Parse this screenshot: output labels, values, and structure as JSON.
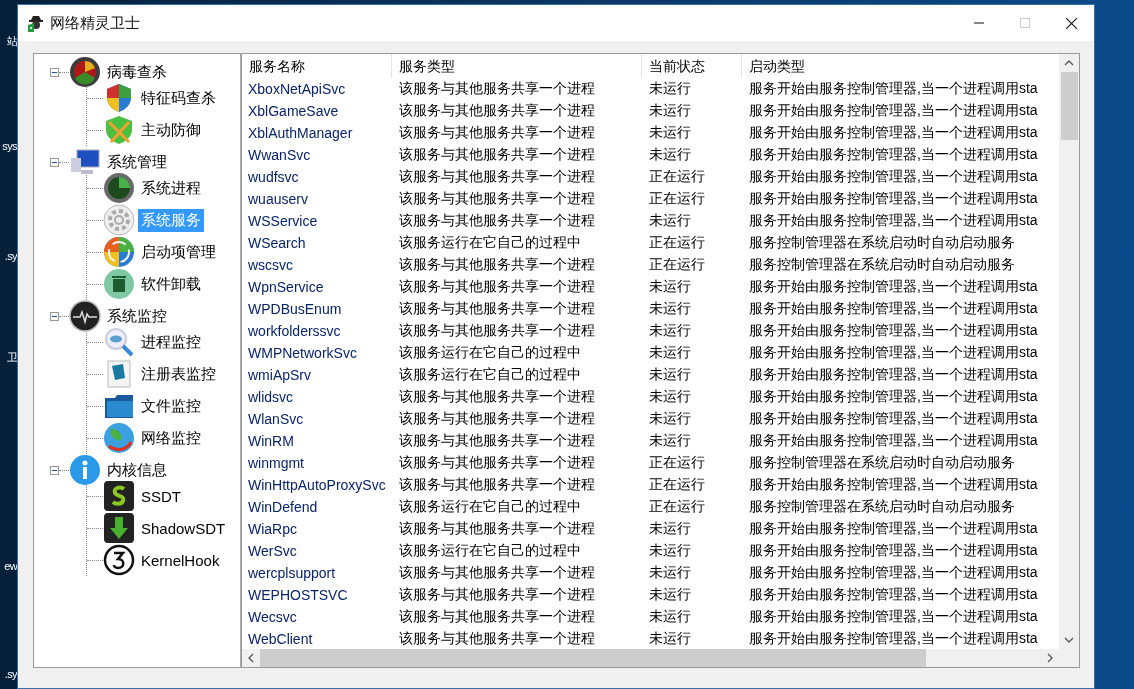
{
  "desktop": {
    "labels": [
      "站",
      "sys",
      ".sy",
      "卫",
      "ew",
      ".sy"
    ]
  },
  "window": {
    "title": "网络精灵卫士",
    "maximize_disabled": true
  },
  "tree": [
    {
      "label": "病毒查杀",
      "expanded": true,
      "selected": false,
      "children": [
        {
          "label": "特征码查杀",
          "selected": false
        },
        {
          "label": "主动防御",
          "selected": false
        }
      ]
    },
    {
      "label": "系统管理",
      "expanded": true,
      "selected": false,
      "children": [
        {
          "label": "系统进程",
          "selected": false
        },
        {
          "label": "系统服务",
          "selected": true
        },
        {
          "label": "启动项管理",
          "selected": false
        },
        {
          "label": "软件卸载",
          "selected": false
        }
      ]
    },
    {
      "label": "系统监控",
      "expanded": true,
      "selected": false,
      "children": [
        {
          "label": "进程监控",
          "selected": false
        },
        {
          "label": "注册表监控",
          "selected": false
        },
        {
          "label": "文件监控",
          "selected": false
        },
        {
          "label": "网络监控",
          "selected": false
        }
      ]
    },
    {
      "label": "内核信息",
      "expanded": true,
      "selected": false,
      "children": [
        {
          "label": "SSDT",
          "selected": false
        },
        {
          "label": "ShadowSDT",
          "selected": false
        },
        {
          "label": "KernelHook",
          "selected": false
        }
      ]
    }
  ],
  "table": {
    "columns": [
      "服务名称",
      "服务类型",
      "当前状态",
      "启动类型"
    ],
    "rows": [
      [
        "XboxNetApiSvc",
        "该服务与其他服务共享一个进程",
        "未运行",
        "服务开始由服务控制管理器,当一个进程调用sta"
      ],
      [
        "XblGameSave",
        "该服务与其他服务共享一个进程",
        "未运行",
        "服务开始由服务控制管理器,当一个进程调用sta"
      ],
      [
        "XblAuthManager",
        "该服务与其他服务共享一个进程",
        "未运行",
        "服务开始由服务控制管理器,当一个进程调用sta"
      ],
      [
        "WwanSvc",
        "该服务与其他服务共享一个进程",
        "未运行",
        "服务开始由服务控制管理器,当一个进程调用sta"
      ],
      [
        "wudfsvc",
        "该服务与其他服务共享一个进程",
        "正在运行",
        "服务开始由服务控制管理器,当一个进程调用sta"
      ],
      [
        "wuauserv",
        "该服务与其他服务共享一个进程",
        "正在运行",
        "服务开始由服务控制管理器,当一个进程调用sta"
      ],
      [
        "WSService",
        "该服务与其他服务共享一个进程",
        "未运行",
        "服务开始由服务控制管理器,当一个进程调用sta"
      ],
      [
        "WSearch",
        "该服务运行在它自己的过程中",
        "正在运行",
        "服务控制管理器在系统启动时自动启动服务"
      ],
      [
        "wscsvc",
        "该服务与其他服务共享一个进程",
        "正在运行",
        "服务控制管理器在系统启动时自动启动服务"
      ],
      [
        "WpnService",
        "该服务与其他服务共享一个进程",
        "未运行",
        "服务开始由服务控制管理器,当一个进程调用sta"
      ],
      [
        "WPDBusEnum",
        "该服务与其他服务共享一个进程",
        "未运行",
        "服务开始由服务控制管理器,当一个进程调用sta"
      ],
      [
        "workfolderssvc",
        "该服务与其他服务共享一个进程",
        "未运行",
        "服务开始由服务控制管理器,当一个进程调用sta"
      ],
      [
        "WMPNetworkSvc",
        "该服务运行在它自己的过程中",
        "未运行",
        "服务开始由服务控制管理器,当一个进程调用sta"
      ],
      [
        "wmiApSrv",
        "该服务运行在它自己的过程中",
        "未运行",
        "服务开始由服务控制管理器,当一个进程调用sta"
      ],
      [
        "wlidsvc",
        "该服务与其他服务共享一个进程",
        "未运行",
        "服务开始由服务控制管理器,当一个进程调用sta"
      ],
      [
        "WlanSvc",
        "该服务与其他服务共享一个进程",
        "未运行",
        "服务开始由服务控制管理器,当一个进程调用sta"
      ],
      [
        "WinRM",
        "该服务与其他服务共享一个进程",
        "未运行",
        "服务开始由服务控制管理器,当一个进程调用sta"
      ],
      [
        "winmgmt",
        "该服务与其他服务共享一个进程",
        "正在运行",
        "服务控制管理器在系统启动时自动启动服务"
      ],
      [
        "WinHttpAutoProxySvc",
        "该服务与其他服务共享一个进程",
        "正在运行",
        "服务开始由服务控制管理器,当一个进程调用sta"
      ],
      [
        "WinDefend",
        "该服务运行在它自己的过程中",
        "正在运行",
        "服务控制管理器在系统启动时自动启动服务"
      ],
      [
        "WiaRpc",
        "该服务与其他服务共享一个进程",
        "未运行",
        "服务开始由服务控制管理器,当一个进程调用sta"
      ],
      [
        "WerSvc",
        "该服务运行在它自己的过程中",
        "未运行",
        "服务开始由服务控制管理器,当一个进程调用sta"
      ],
      [
        "wercplsupport",
        "该服务与其他服务共享一个进程",
        "未运行",
        "服务开始由服务控制管理器,当一个进程调用sta"
      ],
      [
        "WEPHOSTSVC",
        "该服务与其他服务共享一个进程",
        "未运行",
        "服务开始由服务控制管理器,当一个进程调用sta"
      ],
      [
        "Wecsvc",
        "该服务与其他服务共享一个进程",
        "未运行",
        "服务开始由服务控制管理器,当一个进程调用sta"
      ],
      [
        "WebClient",
        "该服务与其他服务共享一个进程",
        "未运行",
        "服务开始由服务控制管理器,当一个进程调用sta"
      ]
    ]
  }
}
